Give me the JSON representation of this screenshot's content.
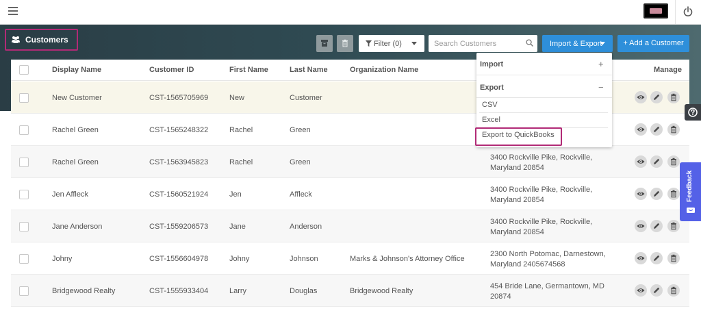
{
  "header": {
    "menu_icon": "hamburger-menu-icon",
    "power_icon": "power-icon"
  },
  "page": {
    "title": "Customers",
    "title_icon": "users-icon"
  },
  "toolbar": {
    "archive_icon": "archive-icon",
    "delete_icon": "trash-icon",
    "filter_label": "Filter (0)",
    "search_placeholder": "Search Customers",
    "import_export_label": "Import & Export",
    "add_customer_label": "+ Add a Customer"
  },
  "dropdown": {
    "import_label": "Import",
    "import_sign": "+",
    "export_label": "Export",
    "export_sign": "−",
    "items": [
      "CSV",
      "Excel",
      "Export to QuickBooks"
    ]
  },
  "table": {
    "columns": [
      "Display Name",
      "Customer ID",
      "First Name",
      "Last Name",
      "Organization Name",
      "Manage"
    ],
    "rows": [
      {
        "display_name": "New Customer",
        "customer_id": "CST-1565705969",
        "first_name": "New",
        "last_name": "Customer",
        "organization": "",
        "address": ""
      },
      {
        "display_name": "Rachel Green",
        "customer_id": "CST-1565248322",
        "first_name": "Rachel",
        "last_name": "Green",
        "organization": "",
        "address": ""
      },
      {
        "display_name": "Rachel Green",
        "customer_id": "CST-1563945823",
        "first_name": "Rachel",
        "last_name": "Green",
        "organization": "",
        "address": "3400 Rockville Pike, Rockville, Maryland 20854"
      },
      {
        "display_name": "Jen Affleck",
        "customer_id": "CST-1560521924",
        "first_name": "Jen",
        "last_name": "Affleck",
        "organization": "",
        "address": "3400 Rockville Pike, Rockville, Maryland 20854"
      },
      {
        "display_name": "Jane Anderson",
        "customer_id": "CST-1559206573",
        "first_name": "Jane",
        "last_name": "Anderson",
        "organization": "",
        "address": "3400 Rockville Pike, Rockville, Maryland 20854"
      },
      {
        "display_name": "Johny",
        "customer_id": "CST-1556604978",
        "first_name": "Johny",
        "last_name": "Johnson",
        "organization": "Marks & Johnson's Attorney Office",
        "address": "2300 North Potomac, Darnestown, Maryland 2405674568"
      },
      {
        "display_name": "Bridgewood Realty",
        "customer_id": "CST-1555933404",
        "first_name": "Larry",
        "last_name": "Douglas",
        "organization": "Bridgewood Realty",
        "address": "454 Bride Lane, Germantown, MD 20874"
      }
    ],
    "row_actions": [
      "view-eye-icon",
      "edit-pencil-icon",
      "delete-trash-icon"
    ]
  },
  "side": {
    "help_icon": "question-circle-icon",
    "feedback_label": "Feedback"
  },
  "colors": {
    "hero_dark": "#2a3d45",
    "primary_blue": "#2e8fda",
    "highlight_magenta": "#b12a76",
    "feedback_purple": "#5461e7"
  }
}
